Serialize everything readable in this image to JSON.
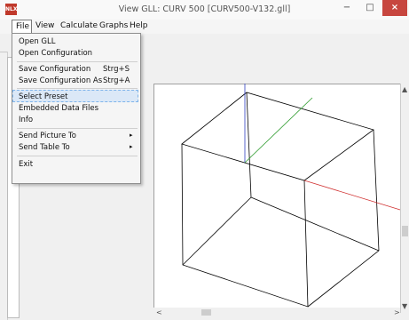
{
  "window": {
    "app_icon_text": "NLX",
    "title": "View GLL: CURV 500 [CURV500-V132.gll]",
    "minimize_symbol": "−",
    "maximize_symbol": "□",
    "close_symbol": "×"
  },
  "menubar": {
    "file": "File",
    "view": "View",
    "calculate": "Calculate",
    "graphs": "Graphs",
    "help": "Help"
  },
  "file_menu": {
    "open_gll": "Open GLL",
    "open_configuration": "Open Configuration",
    "save_configuration": "Save Configuration",
    "save_configuration_shortcut": "Strg+S",
    "save_configuration_as": "Save Configuration As",
    "save_configuration_as_shortcut": "Strg+A",
    "select_preset": "Select Preset",
    "embedded_data_files": "Embedded Data Files",
    "info": "Info",
    "send_picture_to": "Send Picture To",
    "send_table_to": "Send Table To",
    "submenu_arrow": "▸",
    "exit": "Exit"
  },
  "scroll": {
    "up": "▲",
    "down": "▼",
    "left": "<",
    "right": ">"
  },
  "colors": {
    "axis_x": "#d03030",
    "axis_y": "#2a9a2a",
    "axis_z": "#3040c0",
    "cube_edges": "#000000",
    "selection": "#dbe8f7"
  }
}
